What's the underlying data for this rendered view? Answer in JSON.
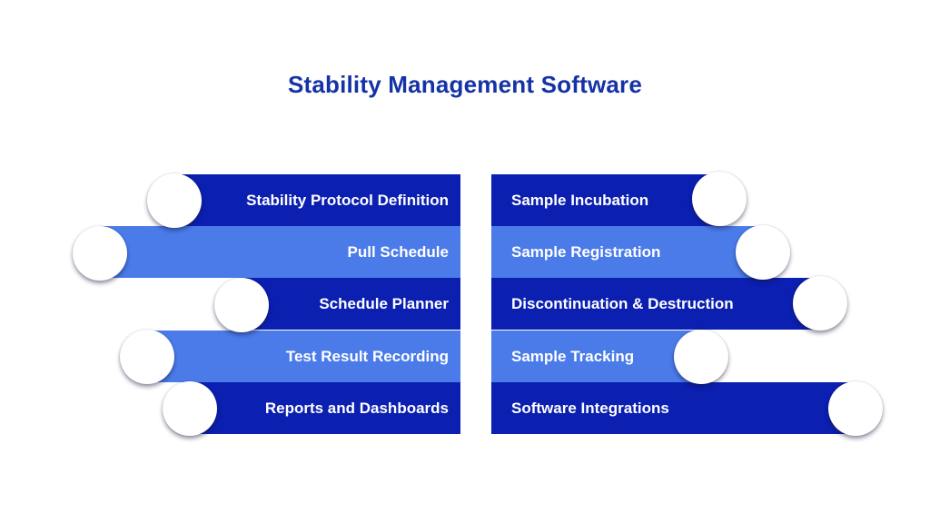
{
  "title": "Stability Management Software",
  "colors": {
    "title": "#1532a6",
    "dark_bar": "#0b1fb0",
    "light_bar": "#4a7be9",
    "circle": "#ffffff"
  },
  "left_items": [
    {
      "label": "Stability Protocol Definition",
      "shade": "dark"
    },
    {
      "label": "Pull Schedule",
      "shade": "light"
    },
    {
      "label": "Schedule Planner",
      "shade": "dark"
    },
    {
      "label": "Test Result Recording",
      "shade": "light"
    },
    {
      "label": "Reports and Dashboards",
      "shade": "dark"
    }
  ],
  "right_items": [
    {
      "label": "Sample Incubation",
      "shade": "dark"
    },
    {
      "label": "Sample Registration",
      "shade": "light"
    },
    {
      "label": "Discontinuation & Destruction",
      "shade": "dark"
    },
    {
      "label": "Sample Tracking",
      "shade": "light"
    },
    {
      "label": "Software Integrations",
      "shade": "dark"
    }
  ]
}
